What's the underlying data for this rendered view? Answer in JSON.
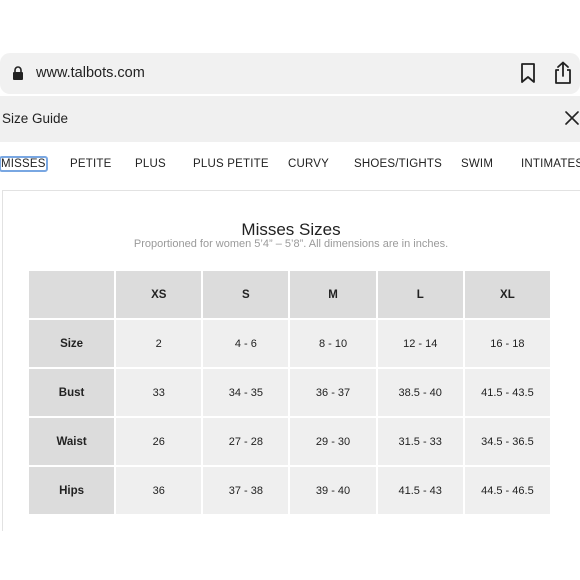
{
  "browser": {
    "url": "www.talbots.com",
    "icons": [
      "lock-icon",
      "bookmark-icon",
      "share-icon"
    ]
  },
  "size_guide": {
    "title": "Size Guide",
    "close_icon": "close-icon"
  },
  "tabs": [
    {
      "label": "MISSES",
      "active": true
    },
    {
      "label": "PETITE",
      "active": false
    },
    {
      "label": "PLUS",
      "active": false
    },
    {
      "label": "PLUS PETITE",
      "active": false
    },
    {
      "label": "CURVY",
      "active": false
    },
    {
      "label": "SHOES/TIGHTS",
      "active": false
    },
    {
      "label": "SWIM",
      "active": false
    },
    {
      "label": "INTIMATES",
      "active": false
    }
  ],
  "chart": {
    "title": "Misses Sizes",
    "subtitle": "Proportioned for women 5’4” – 5’8”. All dimensions are in inches.",
    "columns": [
      "XS",
      "S",
      "M",
      "L",
      "XL"
    ],
    "rows": [
      {
        "label": "Size",
        "values": [
          "2",
          "4 - 6",
          "8 - 10",
          "12 - 14",
          "16 - 18"
        ]
      },
      {
        "label": "Bust",
        "values": [
          "33",
          "34 - 35",
          "36 - 37",
          "38.5 - 40",
          "41.5 - 43.5"
        ]
      },
      {
        "label": "Waist",
        "values": [
          "26",
          "27 - 28",
          "29 - 30",
          "31.5 - 33",
          "34.5 - 36.5"
        ]
      },
      {
        "label": "Hips",
        "values": [
          "36",
          "37 - 38",
          "39 - 40",
          "41.5 - 43",
          "44.5 - 46.5"
        ]
      }
    ]
  },
  "colors": {
    "accent_outline": "#79a7e2",
    "header_cell": "#dcdcdc",
    "data_cell": "#efefef",
    "subtitle": "#9a9a9a"
  }
}
